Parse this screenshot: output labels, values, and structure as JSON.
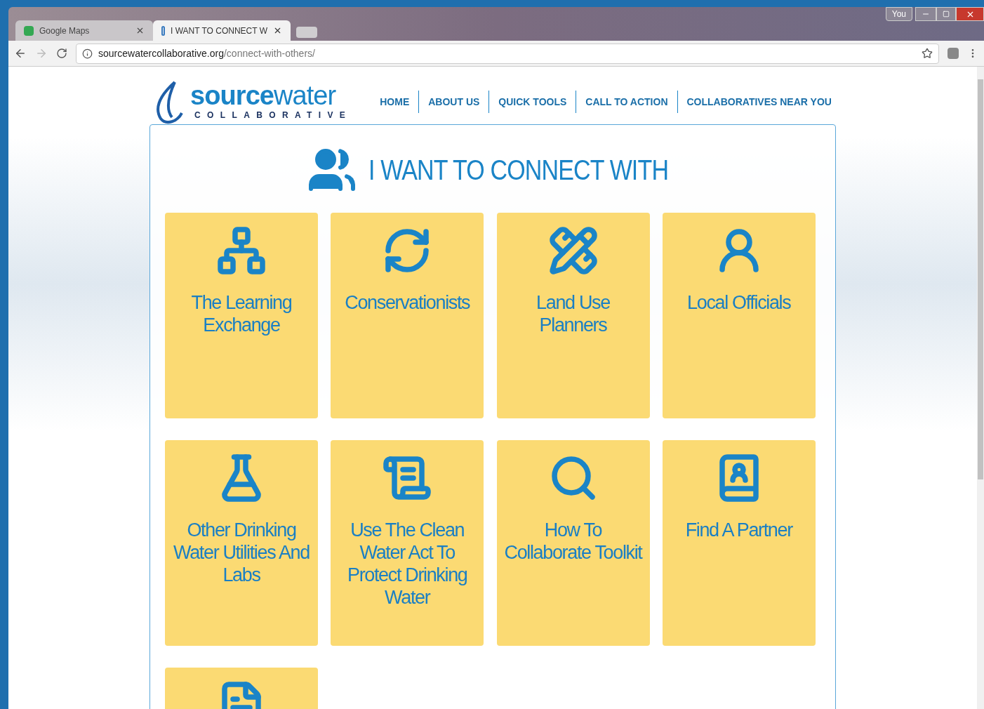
{
  "browser": {
    "tabs": [
      {
        "label": "Google Maps",
        "selected": false
      },
      {
        "label": "I WANT TO CONNECT W",
        "selected": true
      }
    ],
    "profile": "You",
    "url": {
      "domain": "sourcewatercollaborative.org",
      "path": "/connect-with-others/"
    }
  },
  "site": {
    "logo": {
      "word_bold": "source",
      "word_light": "water",
      "subtitle": "COLLABORATIVE"
    },
    "nav": [
      "HOME",
      "ABOUT US",
      "QUICK TOOLS",
      "CALL TO ACTION",
      "COLLABORATIVES NEAR YOU"
    ]
  },
  "heading": "I WANT TO CONNECT WITH",
  "tiles": [
    {
      "kind": "titled",
      "title": "The Learning Exchange"
    },
    {
      "kind": "titled",
      "title": "Conservationists"
    },
    {
      "kind": "titled",
      "title": "Land Use Planners"
    },
    {
      "kind": "titled",
      "title": "Local Officials"
    },
    {
      "kind": "titled",
      "title": "Other Drinking Water Utilities And Labs"
    },
    {
      "kind": "titled",
      "title": "Use The Clean Water Act To Protect Drinking Water"
    },
    {
      "kind": "titled",
      "title": "How To Collaborate Toolkit"
    },
    {
      "kind": "titled",
      "title": "Find A Partner"
    },
    {
      "kind": "cut_off"
    }
  ]
}
